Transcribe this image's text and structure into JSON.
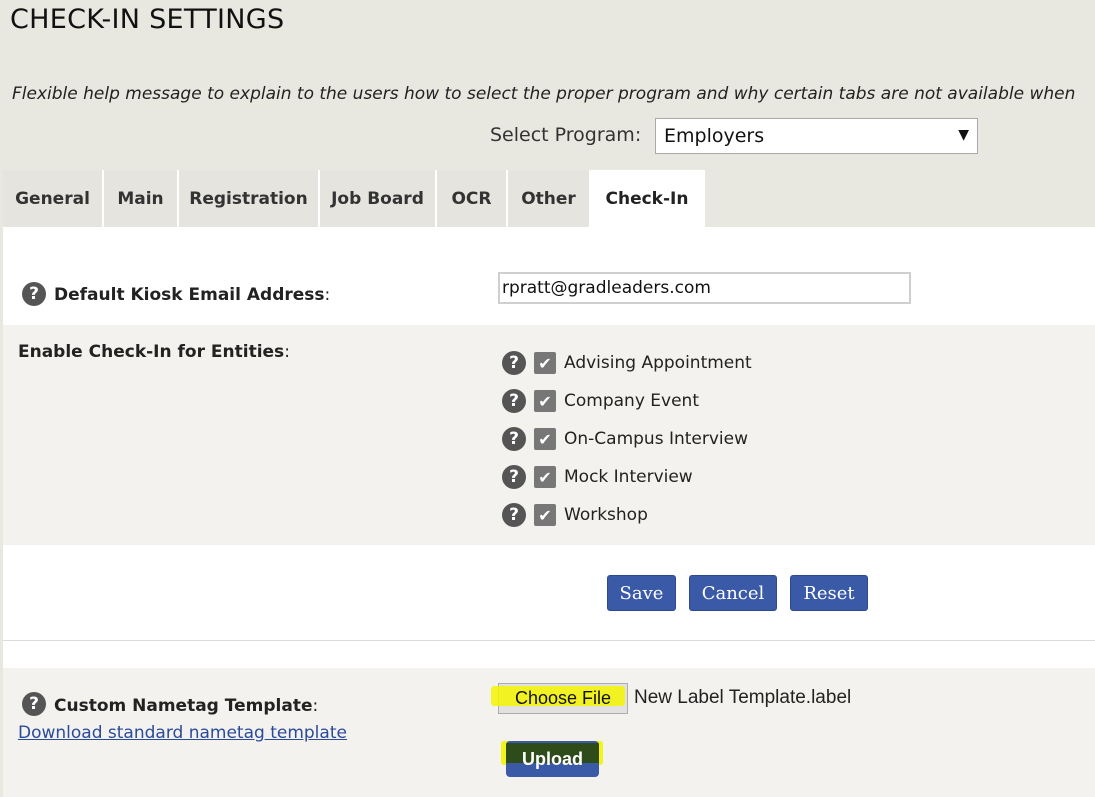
{
  "page": {
    "title": "CHECK-IN SETTINGS",
    "help_message": "Flexible help message to explain to the users how to select the proper program and why certain tabs are not available when"
  },
  "program": {
    "label": "Select Program:",
    "selected": "Employers",
    "arrow": "▼"
  },
  "tabs": [
    {
      "label": "General"
    },
    {
      "label": "Main"
    },
    {
      "label": "Registration"
    },
    {
      "label": "Job Board"
    },
    {
      "label": "OCR"
    },
    {
      "label": "Other"
    },
    {
      "label": "Check-In",
      "active": true
    }
  ],
  "kiosk": {
    "label": "Default Kiosk Email Address",
    "colon": ":",
    "value": "rpratt@gradleaders.com"
  },
  "entities": {
    "label": "Enable Check-In for Entities",
    "colon": ":",
    "items": [
      {
        "label": "Advising Appointment",
        "checked": true
      },
      {
        "label": "Company Event",
        "checked": true
      },
      {
        "label": "On-Campus Interview",
        "checked": true
      },
      {
        "label": "Mock Interview",
        "checked": true
      },
      {
        "label": "Workshop",
        "checked": true
      }
    ]
  },
  "actions": {
    "save": "Save",
    "cancel": "Cancel",
    "reset": "Reset"
  },
  "nametag": {
    "label": "Custom Nametag Template",
    "colon": ":",
    "download_link": "Download standard nametag template",
    "choose_file": "Choose File",
    "file_name": "New Label Template.label",
    "upload": "Upload"
  },
  "icons": {
    "help": "?",
    "check": "✔"
  },
  "colors": {
    "button_blue": "#3a5aa8",
    "highlight_yellow": "#f4f400",
    "background": "#e8e7e0"
  }
}
